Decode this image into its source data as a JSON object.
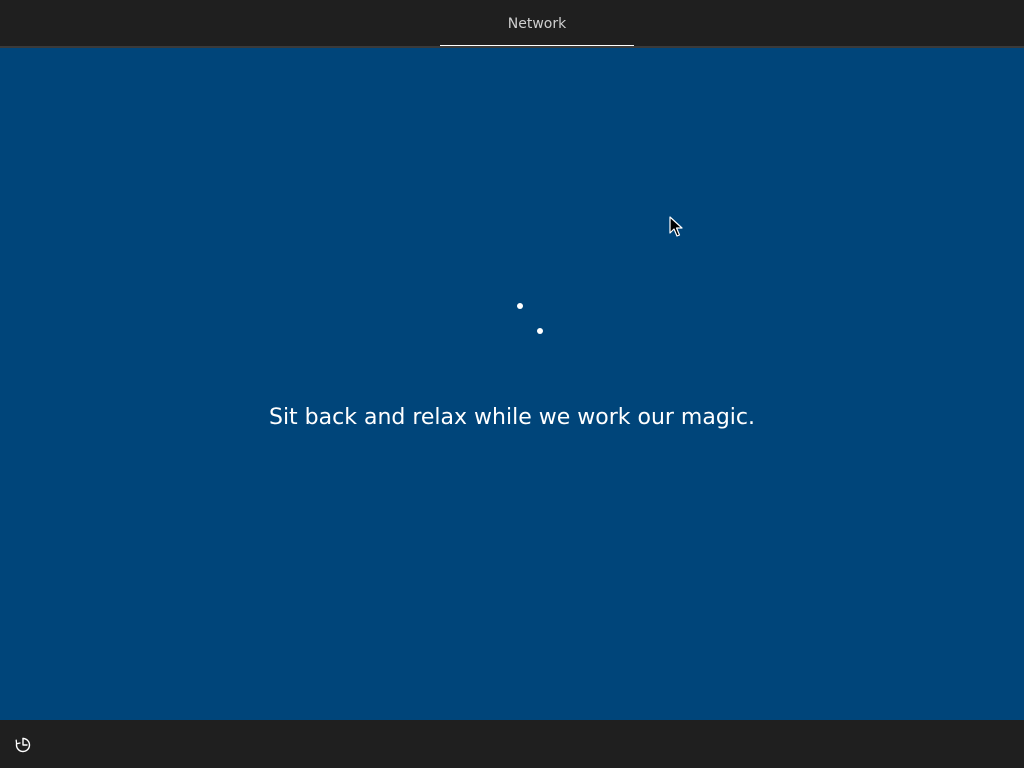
{
  "header": {
    "steps": [
      {
        "label": "Network",
        "active": true
      }
    ]
  },
  "main": {
    "status_message": "Sit back and relax while we work our magic.",
    "spinner": {
      "state": "loading"
    }
  },
  "footer": {
    "accessibility_icon": "ease-of-access-icon"
  },
  "colors": {
    "background": "#00457a",
    "chrome": "#1f1f1f",
    "accent": "#ffffff"
  }
}
